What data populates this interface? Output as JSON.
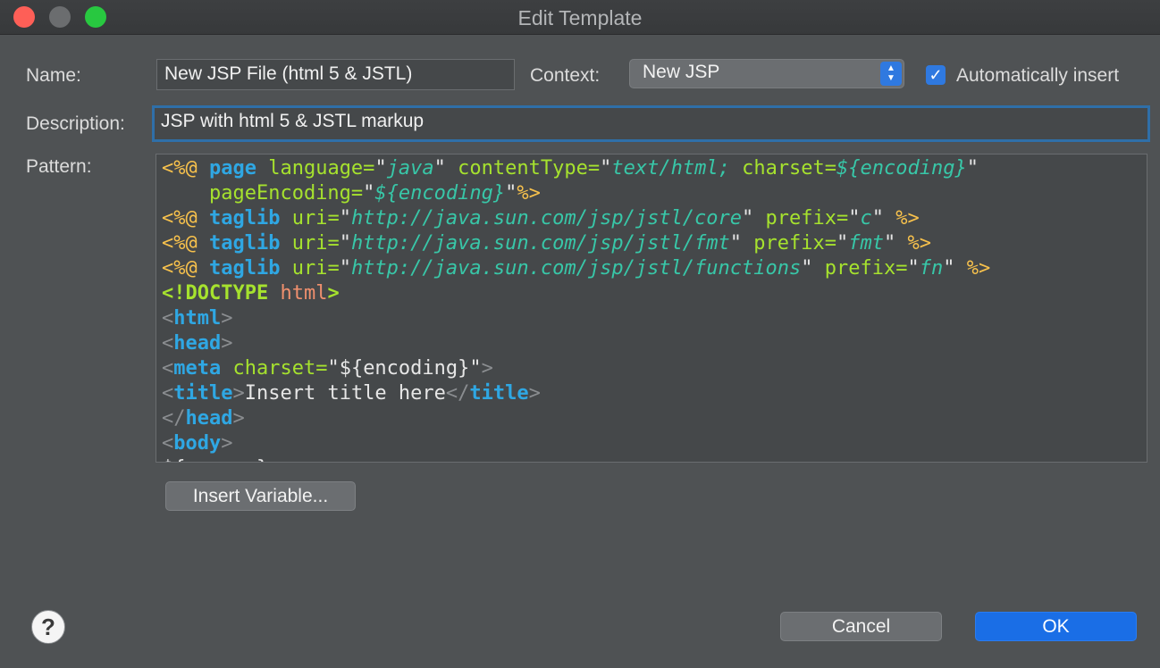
{
  "window": {
    "title": "Edit Template"
  },
  "form": {
    "name_label": "Name:",
    "name_value": "New JSP File (html 5 & JSTL)",
    "context_label": "Context:",
    "context_value": "New JSP",
    "auto_insert_label": "Automatically insert",
    "auto_insert_checked": true,
    "description_label": "Description:",
    "description_value": "JSP with html 5 & JSTL markup",
    "pattern_label": "Pattern:"
  },
  "pattern_lines": [
    [
      [
        "dir",
        "<%@ "
      ],
      [
        "kw",
        "page "
      ],
      [
        "attr",
        "language="
      ],
      [
        "txt",
        "\""
      ],
      [
        "str",
        "java"
      ],
      [
        "txt",
        "\" "
      ],
      [
        "attr",
        "contentType="
      ],
      [
        "txt",
        "\""
      ],
      [
        "str",
        "text/html; "
      ],
      [
        "attr",
        "charset="
      ],
      [
        "str",
        "${encoding}"
      ],
      [
        "txt",
        "\""
      ]
    ],
    [
      [
        "txt",
        "    "
      ],
      [
        "attr",
        "pageEncoding="
      ],
      [
        "txt",
        "\""
      ],
      [
        "str",
        "${encoding}"
      ],
      [
        "txt",
        "\""
      ],
      [
        "dir",
        "%>"
      ]
    ],
    [
      [
        "dir",
        "<%@ "
      ],
      [
        "kw",
        "taglib "
      ],
      [
        "attr",
        "uri="
      ],
      [
        "txt",
        "\""
      ],
      [
        "str",
        "http://java.sun.com/jsp/jstl/core"
      ],
      [
        "txt",
        "\" "
      ],
      [
        "attr",
        "prefix="
      ],
      [
        "txt",
        "\""
      ],
      [
        "str",
        "c"
      ],
      [
        "txt",
        "\" "
      ],
      [
        "dir",
        "%>"
      ]
    ],
    [
      [
        "dir",
        "<%@ "
      ],
      [
        "kw",
        "taglib "
      ],
      [
        "attr",
        "uri="
      ],
      [
        "txt",
        "\""
      ],
      [
        "str",
        "http://java.sun.com/jsp/jstl/fmt"
      ],
      [
        "txt",
        "\" "
      ],
      [
        "attr",
        "prefix="
      ],
      [
        "txt",
        "\""
      ],
      [
        "str",
        "fmt"
      ],
      [
        "txt",
        "\" "
      ],
      [
        "dir",
        "%>"
      ]
    ],
    [
      [
        "dir",
        "<%@ "
      ],
      [
        "kw",
        "taglib "
      ],
      [
        "attr",
        "uri="
      ],
      [
        "txt",
        "\""
      ],
      [
        "str",
        "http://java.sun.com/jsp/jstl/functions"
      ],
      [
        "txt",
        "\" "
      ],
      [
        "attr",
        "prefix="
      ],
      [
        "txt",
        "\""
      ],
      [
        "str",
        "fn"
      ],
      [
        "txt",
        "\" "
      ],
      [
        "dir",
        "%>"
      ]
    ],
    [
      [
        "doct",
        "<!DOCTYPE "
      ],
      [
        "html",
        "html"
      ],
      [
        "doct",
        ">"
      ]
    ],
    [
      [
        "tagp",
        "<"
      ],
      [
        "tag",
        "html"
      ],
      [
        "tagp",
        ">"
      ]
    ],
    [
      [
        "tagp",
        "<"
      ],
      [
        "tag",
        "head"
      ],
      [
        "tagp",
        ">"
      ]
    ],
    [
      [
        "tagp",
        "<"
      ],
      [
        "tag",
        "meta "
      ],
      [
        "attr",
        "charset="
      ],
      [
        "txt",
        "\"${encoding}\""
      ],
      [
        "tagp",
        ">"
      ]
    ],
    [
      [
        "tagp",
        "<"
      ],
      [
        "tag",
        "title"
      ],
      [
        "tagp",
        ">"
      ],
      [
        "txt",
        "Insert title here"
      ],
      [
        "tagp",
        "</"
      ],
      [
        "tag",
        "title"
      ],
      [
        "tagp",
        ">"
      ]
    ],
    [
      [
        "tagp",
        "</"
      ],
      [
        "tag",
        "head"
      ],
      [
        "tagp",
        ">"
      ]
    ],
    [
      [
        "tagp",
        "<"
      ],
      [
        "tag",
        "body"
      ],
      [
        "tagp",
        ">"
      ]
    ],
    [
      [
        "txt",
        "${cursor}"
      ]
    ]
  ],
  "buttons": {
    "insert_variable": "Insert Variable...",
    "cancel": "Cancel",
    "ok": "OK",
    "help": "?"
  }
}
